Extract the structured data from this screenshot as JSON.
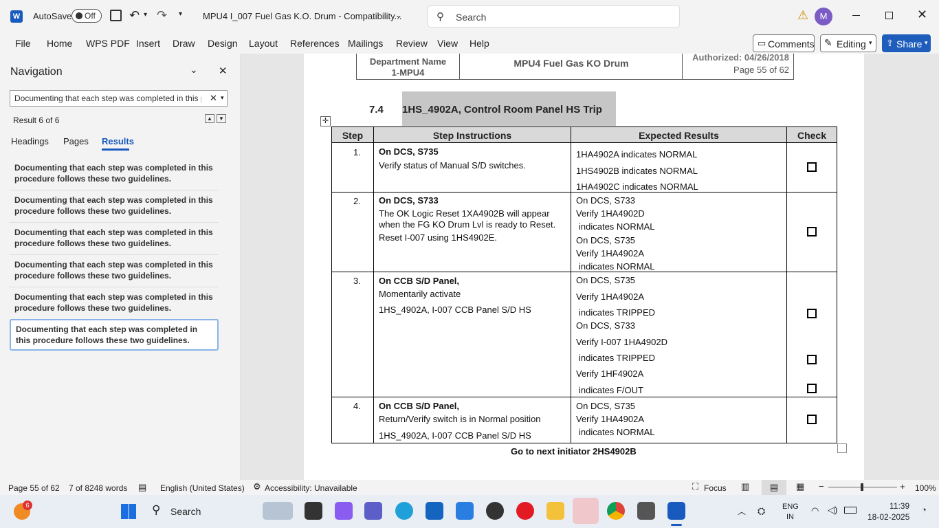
{
  "title_bar": {
    "autosave_label": "AutoSave",
    "autosave_state": "Off",
    "doc_title": "MPU4 I_007 Fuel Gas K.O. Drum  -  Compatibility...",
    "search_placeholder": "Search",
    "user_initial": "M"
  },
  "menu": {
    "items": [
      "File",
      "Home",
      "WPS PDF",
      "Insert",
      "Draw",
      "Design",
      "Layout",
      "References",
      "Mailings",
      "Review",
      "View",
      "Help"
    ],
    "comments": "Comments",
    "editing": "Editing",
    "share": "Share"
  },
  "nav": {
    "title": "Navigation",
    "search_value": "Documenting that each step was completed in this p",
    "result_count": "Result 6 of 6",
    "tabs": [
      "Headings",
      "Pages",
      "Results"
    ],
    "results": [
      "Documenting that each step was completed in this procedure follows these two guidelines.",
      "Documenting that each step was completed in this procedure follows these two guidelines.",
      "Documenting that each step was completed in this procedure follows these two guidelines.",
      "Documenting that each step was completed in this procedure follows these two guidelines.",
      "Documenting that each step was completed in this procedure follows these two guidelines.",
      "Documenting that each step was completed in this procedure follows these two guidelines."
    ]
  },
  "doc": {
    "header": {
      "dept_line": "Department Name",
      "dept_code": "1-MPU4",
      "center": "MPU4 Fuel Gas KO Drum",
      "authorized": "Authorized: 04/26/2018",
      "page": "Page 55 of 62"
    },
    "section_num": "7.4",
    "section_title": "1HS_4902A, Control Room Panel HS Trip",
    "table_headers": [
      "Step",
      "Step Instructions",
      "Expected Results",
      "Check"
    ],
    "steps": [
      {
        "num": "1.",
        "instr_bold": "On DCS, S735",
        "instr": [
          "Verify status of Manual S/D switches."
        ],
        "results": [
          "1HA4902A indicates NORMAL",
          "1HS4902B indicates NORMAL",
          "1HA4902C indicates NORMAL"
        ]
      },
      {
        "num": "2.",
        "instr_bold": "On DCS, S733",
        "instr": [
          "The OK Logic Reset 1XA4902B will appear",
          "when the FG KO Drum Lvl is ready to Reset.",
          "Reset I-007 using 1HS4902E."
        ],
        "results": [
          "On DCS, S733",
          "Verify 1HA4902D",
          "indicates NORMAL",
          "On DCS, S735",
          "Verify 1HA4902A",
          "indicates NORMAL"
        ]
      },
      {
        "num": "3.",
        "instr_bold": "On CCB S/D Panel,",
        "instr": [
          "Momentarily activate",
          "1HS_4902A, I-007 CCB Panel S/D HS"
        ],
        "results": [
          "On DCS, S735",
          "Verify 1HA4902A",
          "indicates TRIPPED",
          "On DCS, S733",
          "Verify I-007 1HA4902D",
          "indicates TRIPPED",
          "Verify 1HF4902A",
          "indicates F/OUT"
        ]
      },
      {
        "num": "4.",
        "instr_bold": "On CCB S/D Panel,",
        "instr": [
          "Return/Verify switch is in Normal position",
          "1HS_4902A, I-007 CCB Panel S/D HS"
        ],
        "results": [
          "On DCS, S735",
          "Verify 1HA4902A",
          "indicates NORMAL"
        ]
      }
    ],
    "footer_line": "Go to next initiator 2HS4902B"
  },
  "status": {
    "page": "Page 55 of 62",
    "words": "7 of 8248 words",
    "language": "English (United States)",
    "accessibility": "Accessibility: Unavailable",
    "focus": "Focus",
    "zoom": "100%"
  },
  "taskbar": {
    "search": "Search",
    "badge": "6",
    "lang1": "ENG",
    "lang2": "IN",
    "time": "11:39",
    "date": "18-02-2025"
  }
}
